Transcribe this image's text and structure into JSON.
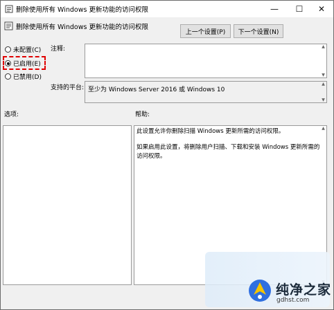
{
  "window": {
    "title": "删除使用所有 Windows 更新功能的访问权限",
    "minimize_glyph": "—",
    "maximize_glyph": "☐",
    "close_glyph": "✕"
  },
  "header": {
    "setting_title": "删除使用所有 Windows 更新功能的访问权限",
    "prev_button": "上一个设置(P)",
    "next_button": "下一个设置(N)"
  },
  "state_options": [
    {
      "label": "未配置(C)",
      "selected": false
    },
    {
      "label": "已启用(E)",
      "selected": true
    },
    {
      "label": "已禁用(D)",
      "selected": false
    }
  ],
  "comment": {
    "label": "注释:",
    "value": ""
  },
  "supported": {
    "label": "支持的平台:",
    "value": "至少为 Windows Server 2016 或 Windows 10"
  },
  "options": {
    "label": "选项:"
  },
  "help": {
    "label": "帮助:",
    "paragraphs": [
      "此设置允许你删除扫描 Windows 更新所需的访问权限。",
      "如果启用此设置，将删除用户扫描、下载和安装 Windows 更新所需的访问权限。"
    ]
  },
  "watermark": {
    "name": "纯净之家",
    "url": "gdhst.com"
  },
  "colors": {
    "highlight": "#e00000",
    "window_bg": "#f0f0f0",
    "logo_blue": "#2f6fe0",
    "logo_yellow": "#f5c400"
  }
}
